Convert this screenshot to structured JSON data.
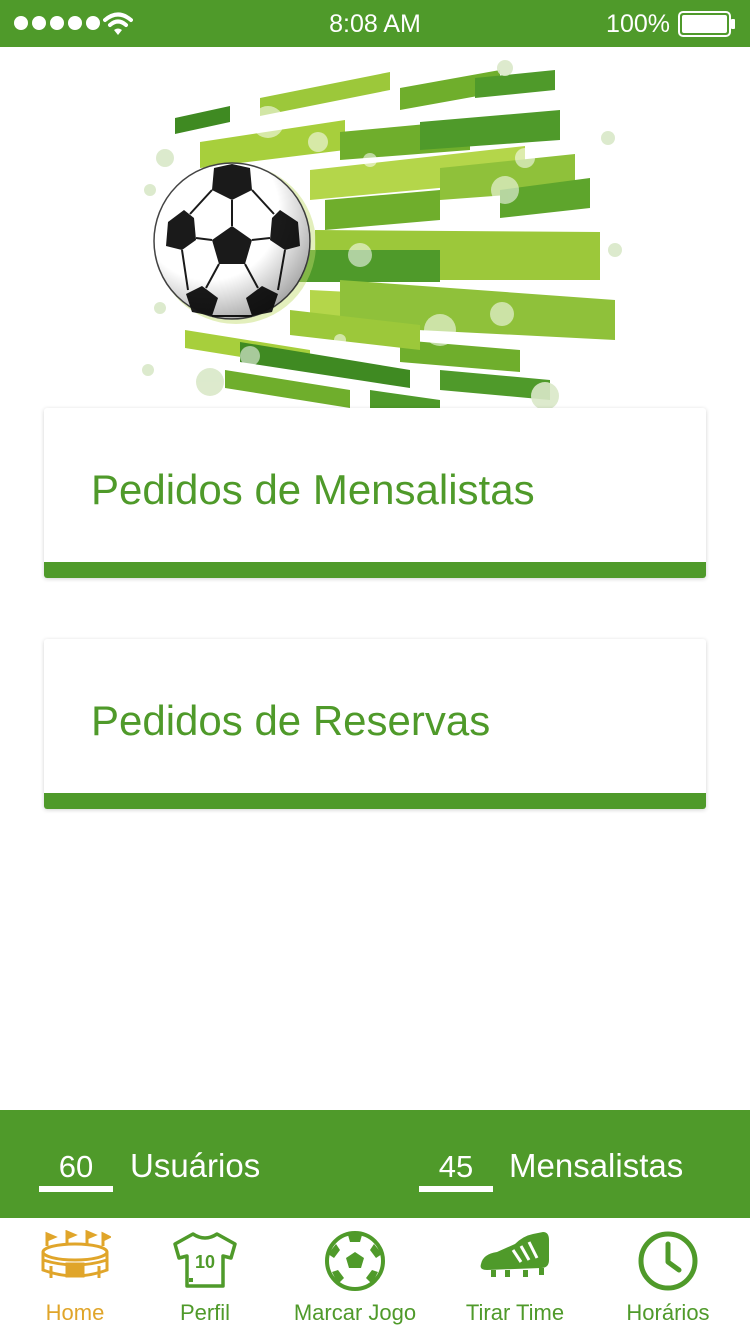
{
  "status_bar": {
    "time": "8:08 AM",
    "battery": "100%",
    "signal_icon": "signal-dots-icon",
    "wifi_icon": "wifi-icon",
    "battery_icon": "battery-icon"
  },
  "cards": [
    {
      "label": "Pedidos de Mensalistas"
    },
    {
      "label": "Pedidos de Reservas"
    }
  ],
  "stats": [
    {
      "value": "60",
      "label": "Usuários"
    },
    {
      "value": "45",
      "label": "Mensalistas"
    }
  ],
  "tabs": [
    {
      "label": "Home",
      "icon": "stadium-icon",
      "active": true
    },
    {
      "label": "Perfil",
      "icon": "jersey-icon",
      "active": false
    },
    {
      "label": "Marcar Jogo",
      "icon": "soccer-ball-icon",
      "active": false
    },
    {
      "label": "Tirar Time",
      "icon": "cleat-icon",
      "active": false
    },
    {
      "label": "Horários",
      "icon": "clock-icon",
      "active": false
    }
  ],
  "colors": {
    "primary": "#4f9a2a",
    "active_tab": "#e0a52a",
    "background": "#ffffff"
  }
}
